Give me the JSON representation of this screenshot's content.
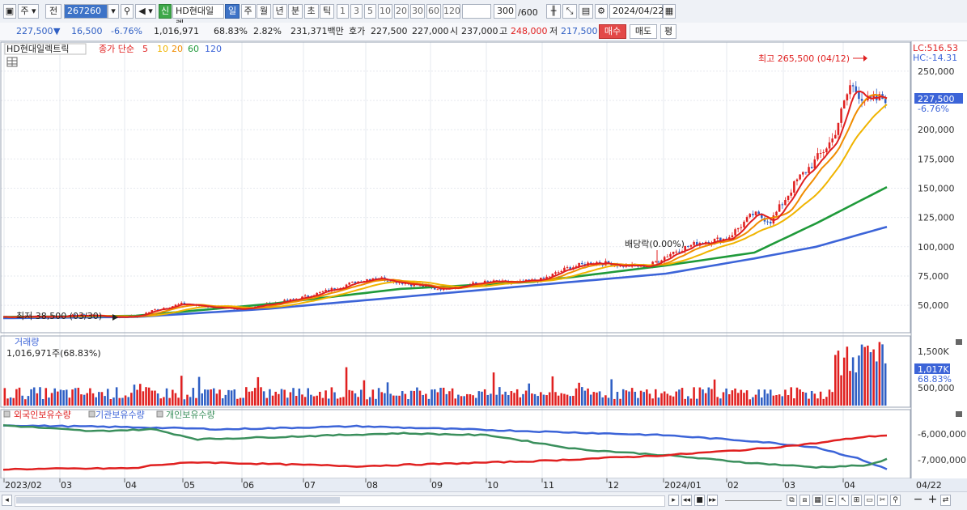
{
  "toolbar": {
    "market_label": "주",
    "prev_label": "전",
    "stock_code": "267260",
    "stock_name": "HD현대일렉",
    "new_badge": "신",
    "period_buttons": [
      "일",
      "주",
      "월",
      "년",
      "분",
      "초",
      "틱"
    ],
    "selected_period": "일",
    "interval_buttons": [
      "1",
      "3",
      "5",
      "10",
      "20",
      "30",
      "60",
      "120"
    ],
    "count_value": "300",
    "count_total": "/600",
    "date_value": "2024/04/22"
  },
  "quote": {
    "price": "227,500",
    "change_arrow": "▼",
    "change": "16,500",
    "change_pct": "-6.76%",
    "volume": "1,016,971",
    "volume_ratio": "68.83%",
    "turnover": "2.82%",
    "amount": "231,371백만",
    "ask_label": "호가",
    "ask_price": "227,500",
    "bid_price": "227,000",
    "open_label": "시",
    "open_price": "237,000",
    "high_label": "고",
    "high_price": "248,000",
    "low_label": "저",
    "low_price": "217,500",
    "buy_label": "매수",
    "sell_label": "매도",
    "eval_label": "평"
  },
  "legend": {
    "name": "HD현대일렉트릭",
    "close_label": "종가 단순",
    "ma": [
      "5",
      "10",
      "20",
      "60",
      "120"
    ],
    "lc": "LC:516.53",
    "hc": "HC:-14.31"
  },
  "annotations": {
    "high": "최고 265,500 (04/12)",
    "low": "최저 38,500 (03/30)",
    "dividend": "배당락(0.00%)"
  },
  "price_axis": {
    "current_price": "227,500",
    "current_change": "-6.76%",
    "ticks": [
      "250,000",
      "225,000",
      "200,000",
      "175,000",
      "150,000",
      "125,000",
      "100,000",
      "75,000",
      "50,000"
    ]
  },
  "volume_panel": {
    "title": "거래량",
    "value": "1,016,971주(68.83%)",
    "ticks": [
      "1,500K",
      "500,000"
    ],
    "current": "1,017K",
    "current_pct": "68.83%"
  },
  "holdings_panel": {
    "series_labels": [
      "외국인보유수량",
      "기관보유수량",
      "개인보유수량"
    ],
    "ticks": [
      "-6,000,000",
      "-7,000,000"
    ]
  },
  "x_axis": {
    "labels": [
      "2023/02",
      "03",
      "04",
      "05",
      "06",
      "07",
      "08",
      "09",
      "10",
      "11",
      "12",
      "2024/01",
      "02",
      "03",
      "04"
    ],
    "last_date": "04/22"
  },
  "colors": {
    "candle_up": "#e02020",
    "candle_down": "#2f5fc4",
    "ma5": "#e02020",
    "ma10": "#f0b400",
    "ma20": "#f08c00",
    "ma60": "#1f9a3a",
    "ma120": "#3c64d8",
    "foreign": "#e02020",
    "institution": "#3c64d8",
    "individual": "#3a8f5c"
  },
  "chart_data": {
    "type": "candlestick",
    "price_y_range": [
      30000,
      270000
    ],
    "close_path": [
      [
        0,
        40000
      ],
      [
        0.06,
        40500
      ],
      [
        0.1,
        41500
      ],
      [
        0.12,
        40000
      ],
      [
        0.15,
        40500
      ],
      [
        0.17,
        46000
      ],
      [
        0.2,
        51000
      ],
      [
        0.23,
        49000
      ],
      [
        0.26,
        46000
      ],
      [
        0.3,
        51000
      ],
      [
        0.33,
        55000
      ],
      [
        0.36,
        61000
      ],
      [
        0.39,
        68000
      ],
      [
        0.42,
        74000
      ],
      [
        0.44,
        71000
      ],
      [
        0.47,
        67000
      ],
      [
        0.49,
        64000
      ],
      [
        0.52,
        67000
      ],
      [
        0.55,
        70000
      ],
      [
        0.58,
        69000
      ],
      [
        0.61,
        72000
      ],
      [
        0.64,
        82000
      ],
      [
        0.67,
        87000
      ],
      [
        0.7,
        84000
      ],
      [
        0.73,
        83000
      ],
      [
        0.76,
        96000
      ],
      [
        0.79,
        104000
      ],
      [
        0.82,
        107000
      ],
      [
        0.85,
        128000
      ],
      [
        0.87,
        122000
      ],
      [
        0.9,
        157000
      ],
      [
        0.92,
        173000
      ],
      [
        0.94,
        192000
      ],
      [
        0.96,
        238000
      ],
      [
        0.98,
        224000
      ],
      [
        1.0,
        227500
      ]
    ],
    "ma120_path": [
      [
        0,
        39000
      ],
      [
        0.15,
        40000
      ],
      [
        0.3,
        47000
      ],
      [
        0.45,
        57000
      ],
      [
        0.6,
        67000
      ],
      [
        0.75,
        77000
      ],
      [
        0.85,
        90000
      ],
      [
        0.92,
        100000
      ],
      [
        1.0,
        117000
      ]
    ],
    "ma60_path": [
      [
        0,
        40000
      ],
      [
        0.15,
        41000
      ],
      [
        0.3,
        51000
      ],
      [
        0.45,
        64000
      ],
      [
        0.6,
        70000
      ],
      [
        0.75,
        84000
      ],
      [
        0.85,
        95000
      ],
      [
        0.92,
        120000
      ],
      [
        1.0,
        151000
      ]
    ],
    "volume_y_range": [
      0,
      1600000
    ],
    "volume_bars_note": "daily volume bars, red=up blue=down",
    "holdings_y_range": [
      -7800000,
      -4800000
    ]
  }
}
